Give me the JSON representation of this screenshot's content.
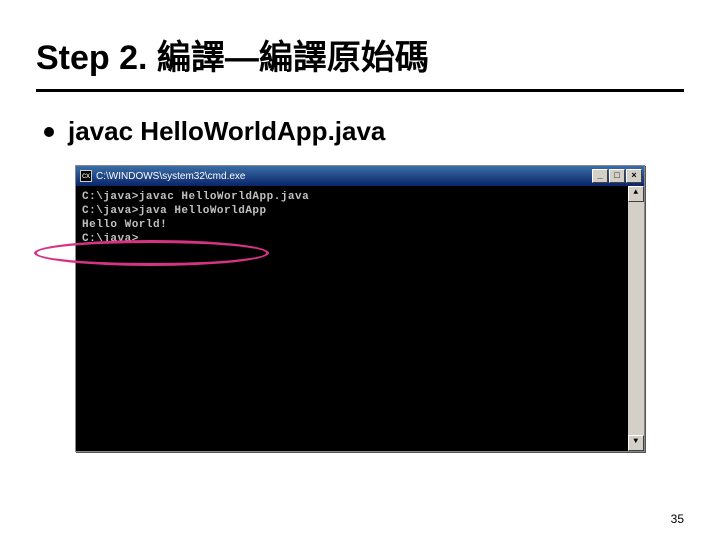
{
  "title": "Step 2. 編譯—編譯原始碼",
  "bullet": "javac HelloWorldApp.java",
  "cmd": {
    "window_title": "C:\\WINDOWS\\system32\\cmd.exe",
    "icon_label": "cx",
    "buttons": {
      "min": "_",
      "max": "□",
      "close": "×"
    },
    "lines": [
      "C:\\java>javac HelloWorldApp.java",
      "",
      "C:\\java>java HelloWorldApp",
      "Hello World!",
      "",
      "C:\\java>"
    ],
    "scroll": {
      "up": "▲",
      "down": "▼"
    }
  },
  "page_number": "35"
}
